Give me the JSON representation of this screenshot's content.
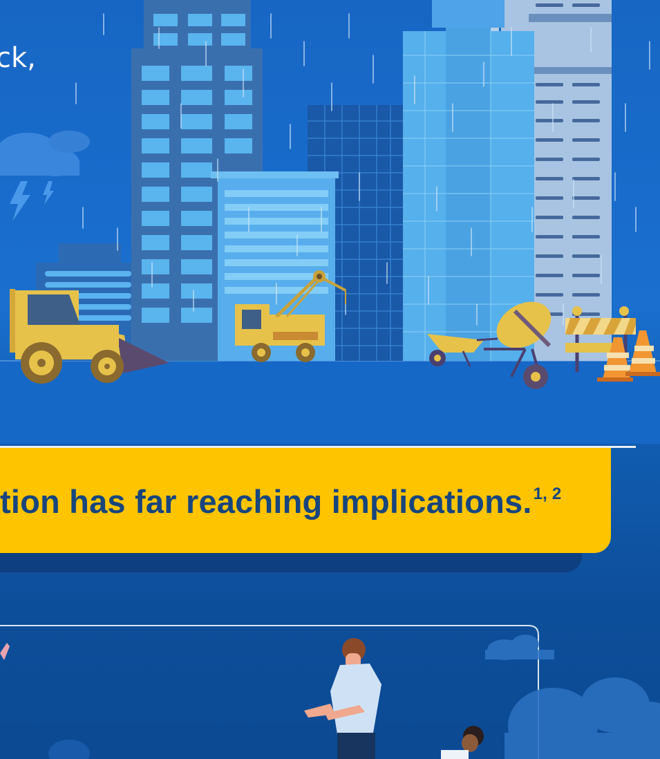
{
  "intro": {
    "partial_text": "ck,"
  },
  "banner": {
    "text": "tion has far reaching implications.",
    "superscript": "1, 2"
  },
  "colors": {
    "background_blue": "#1766c4",
    "banner_yellow": "#fec400",
    "banner_text": "#17457e",
    "machinery_yellow": "#e8c34c",
    "cone_orange": "#f29632"
  },
  "icons": [
    "lightning-icon",
    "cloud-icon",
    "bulldozer-icon",
    "crane-truck-icon",
    "wheelbarrow-icon",
    "cement-mixer-icon",
    "road-barrier-icon",
    "traffic-cone-icon",
    "person-icon"
  ]
}
